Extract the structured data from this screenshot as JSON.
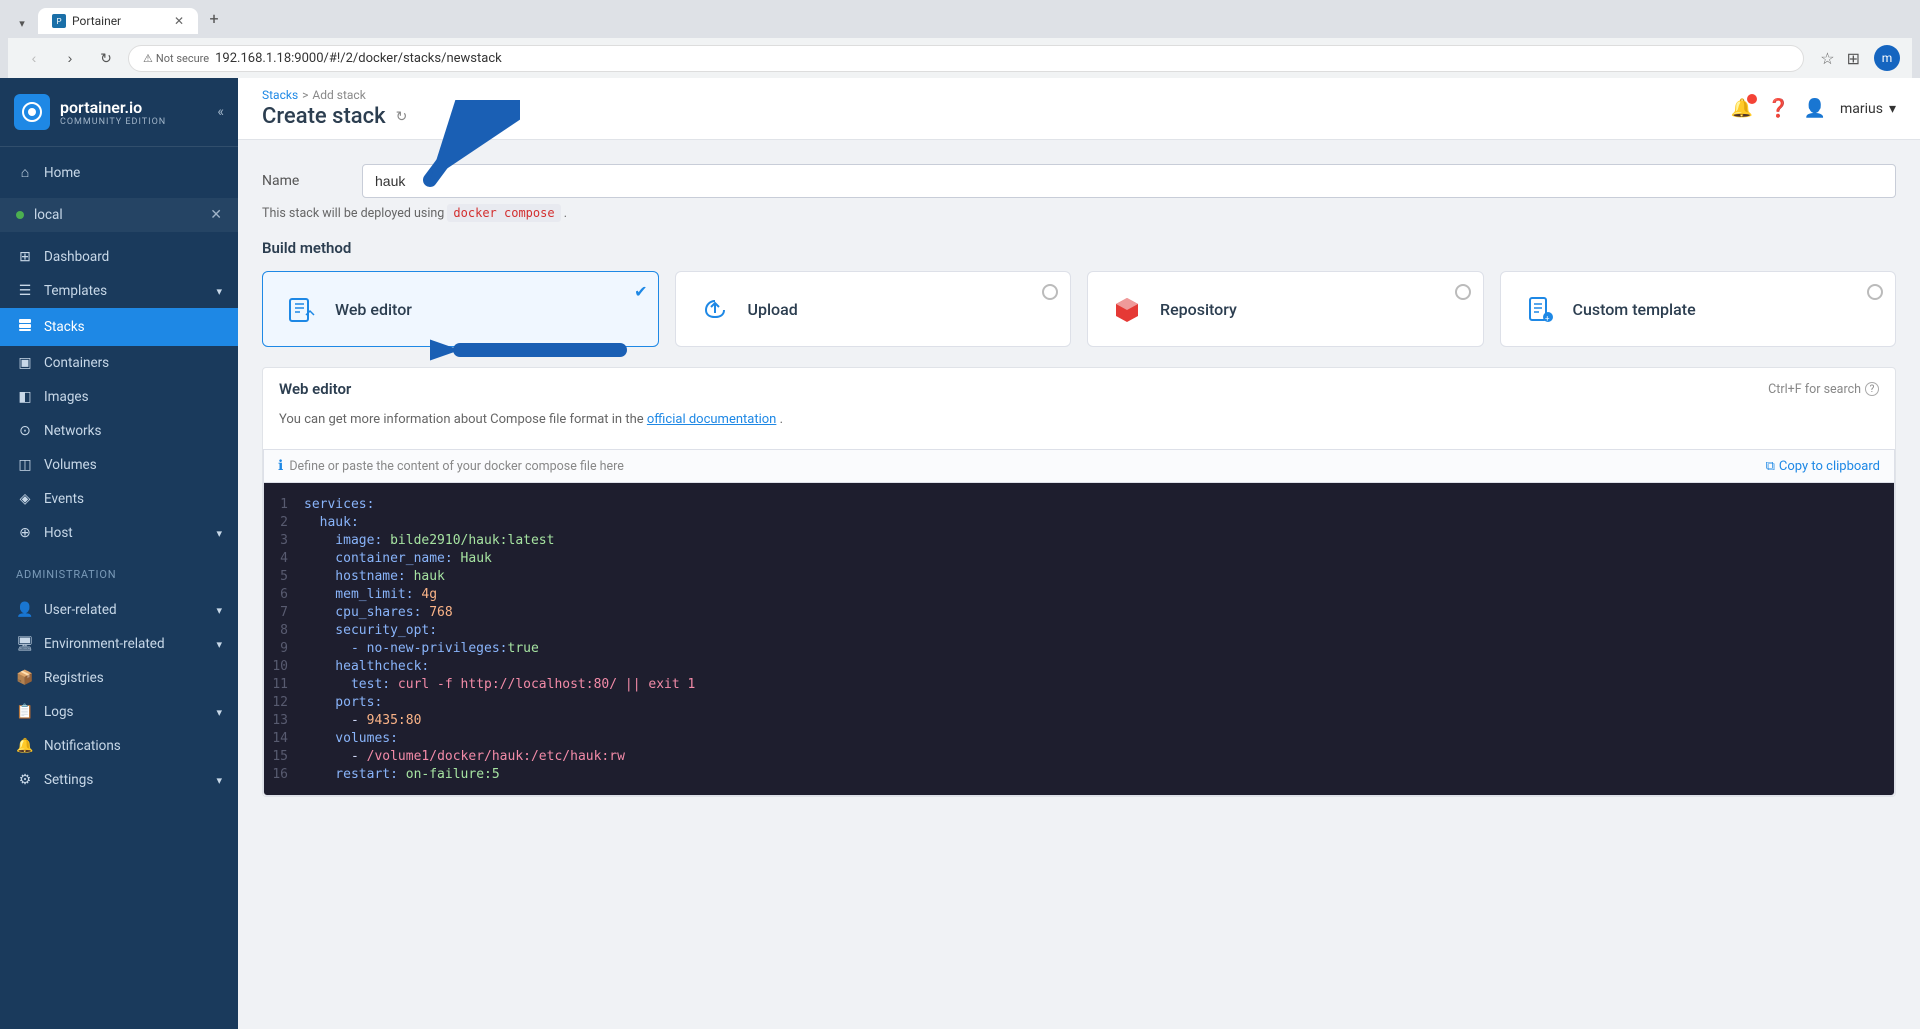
{
  "browser": {
    "tab_label": "Portainer",
    "tab_favicon": "P",
    "url": "192.168.1.18:9000/#!/2/docker/stacks/newstack",
    "not_secure_label": "Not secure",
    "user_avatar_initial": "m"
  },
  "sidebar": {
    "logo_text": "portainer.io",
    "logo_sub": "community edition",
    "collapse_icon": "«",
    "environment": {
      "name": "local",
      "status_color": "#4caf50"
    },
    "nav_items": [
      {
        "id": "home",
        "label": "Home",
        "icon": "⌂"
      },
      {
        "id": "dashboard",
        "label": "Dashboard",
        "icon": "▦"
      },
      {
        "id": "templates",
        "label": "Templates",
        "icon": "⊞",
        "has_expand": true
      },
      {
        "id": "stacks",
        "label": "Stacks",
        "icon": "⊟",
        "active": true
      },
      {
        "id": "containers",
        "label": "Containers",
        "icon": "▣"
      },
      {
        "id": "images",
        "label": "Images",
        "icon": "◧"
      },
      {
        "id": "networks",
        "label": "Networks",
        "icon": "⊙"
      },
      {
        "id": "volumes",
        "label": "Volumes",
        "icon": "◫"
      },
      {
        "id": "events",
        "label": "Events",
        "icon": "◈"
      },
      {
        "id": "host",
        "label": "Host",
        "icon": "⊕",
        "has_expand": true
      }
    ],
    "admin_section": {
      "title": "Administration",
      "items": [
        {
          "id": "user-related",
          "label": "User-related",
          "icon": "👤",
          "has_expand": true
        },
        {
          "id": "environment-related",
          "label": "Environment-related",
          "icon": "🖥",
          "has_expand": true
        },
        {
          "id": "registries",
          "label": "Registries",
          "icon": "📦"
        },
        {
          "id": "logs",
          "label": "Logs",
          "icon": "📋",
          "has_expand": true
        },
        {
          "id": "notifications",
          "label": "Notifications",
          "icon": "🔔"
        },
        {
          "id": "settings",
          "label": "Settings",
          "icon": "⚙",
          "has_expand": true
        }
      ]
    }
  },
  "topbar": {
    "breadcrumb": {
      "stacks_label": "Stacks",
      "separator": ">",
      "current_label": "Add stack"
    },
    "page_title": "Create stack",
    "user_name": "marius"
  },
  "form": {
    "name_label": "Name",
    "name_value": "hauk",
    "helper_text_prefix": "This stack will be deployed using",
    "helper_code": "docker compose",
    "helper_text_suffix": "."
  },
  "build_method": {
    "section_title": "Build method",
    "methods": [
      {
        "id": "web-editor",
        "label": "Web editor",
        "icon": "✏",
        "selected": true
      },
      {
        "id": "upload",
        "label": "Upload",
        "icon": "☁",
        "selected": false
      },
      {
        "id": "repository",
        "label": "Repository",
        "icon": "◆",
        "selected": false
      },
      {
        "id": "custom-template",
        "label": "Custom template",
        "icon": "📄",
        "selected": false
      }
    ]
  },
  "web_editor": {
    "section_title": "Web editor",
    "search_hint": "Ctrl+F for search",
    "info_text_prefix": "You can get more information about Compose file format in the",
    "info_link_text": "official documentation",
    "info_text_suffix": ".",
    "define_hint": "Define or paste the content of your docker compose file here",
    "copy_btn_label": "Copy to clipboard",
    "code_lines": [
      {
        "num": 1,
        "code": "services:",
        "type": "key"
      },
      {
        "num": 2,
        "code": "  hauk:",
        "type": "key"
      },
      {
        "num": 3,
        "code": "    image: bilde2910/hauk:latest",
        "parts": [
          {
            "text": "    image: ",
            "cls": "c-key"
          },
          {
            "text": "bilde2910/hauk:latest",
            "cls": "c-val"
          }
        ]
      },
      {
        "num": 4,
        "code": "    container_name: Hauk",
        "parts": [
          {
            "text": "    container_name: ",
            "cls": "c-key"
          },
          {
            "text": "Hauk",
            "cls": "c-val"
          }
        ]
      },
      {
        "num": 5,
        "code": "    hostname: hauk",
        "parts": [
          {
            "text": "    hostname: ",
            "cls": "c-key"
          },
          {
            "text": "hauk",
            "cls": "c-val"
          }
        ]
      },
      {
        "num": 6,
        "code": "    mem_limit: 4g",
        "parts": [
          {
            "text": "    mem_limit: ",
            "cls": "c-key"
          },
          {
            "text": "4g",
            "cls": "c-num"
          }
        ]
      },
      {
        "num": 7,
        "code": "    cpu_shares: 768",
        "parts": [
          {
            "text": "    cpu_shares: ",
            "cls": "c-key"
          },
          {
            "text": "768",
            "cls": "c-num"
          }
        ]
      },
      {
        "num": 8,
        "code": "    security_opt:",
        "type": "key"
      },
      {
        "num": 9,
        "code": "      - no-new-privileges:true",
        "parts": [
          {
            "text": "      - no-new-privileges:",
            "cls": "c-key"
          },
          {
            "text": "true",
            "cls": "c-val"
          }
        ]
      },
      {
        "num": 10,
        "code": "    healthcheck:",
        "type": "key"
      },
      {
        "num": 11,
        "code": "      test: curl -f http://localhost:80/ || exit 1",
        "parts": [
          {
            "text": "      test: ",
            "cls": "c-key"
          },
          {
            "text": "curl -f http://localhost:80/ || exit 1",
            "cls": "c-str"
          }
        ]
      },
      {
        "num": 12,
        "code": "    ports:",
        "type": "key"
      },
      {
        "num": 13,
        "code": "      - 9435:80",
        "parts": [
          {
            "text": "      - ",
            "cls": ""
          },
          {
            "text": "9435:80",
            "cls": "c-num"
          }
        ]
      },
      {
        "num": 14,
        "code": "    volumes:",
        "type": "key"
      },
      {
        "num": 15,
        "code": "      - /volume1/docker/hauk:/etc/hauk:rw",
        "parts": [
          {
            "text": "      - ",
            "cls": ""
          },
          {
            "text": "/volume1/docker/hauk:/etc/hauk:rw",
            "cls": "c-str"
          }
        ]
      },
      {
        "num": 16,
        "code": "    restart: on-failure:5",
        "parts": [
          {
            "text": "    restart: ",
            "cls": "c-key"
          },
          {
            "text": "on-failure:5",
            "cls": "c-val"
          }
        ]
      }
    ]
  }
}
